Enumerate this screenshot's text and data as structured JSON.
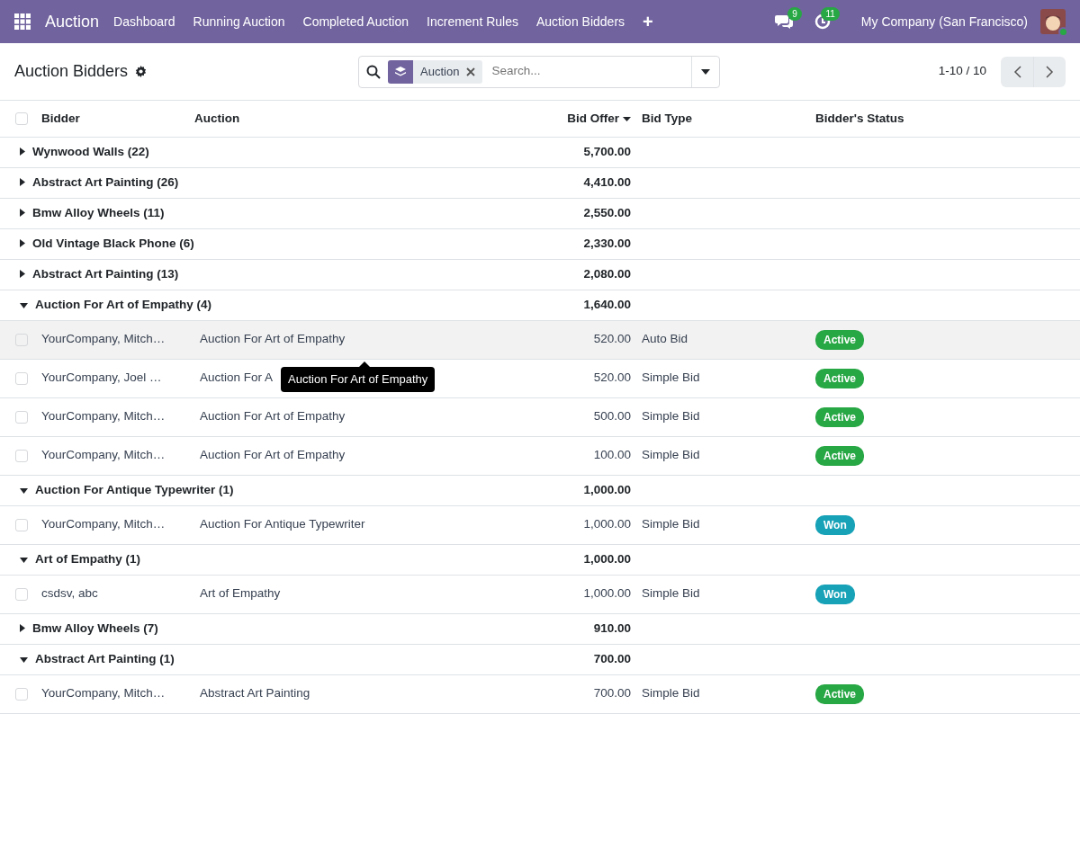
{
  "navbar": {
    "app_name": "Auction",
    "menu": [
      "Dashboard",
      "Running Auction",
      "Completed Auction",
      "Increment Rules",
      "Auction Bidders"
    ],
    "plus": "+",
    "messages_count": "9",
    "activities_count": "11",
    "company": "My Company (San Francisco)",
    "user_online": true
  },
  "control_panel": {
    "title": "Auction Bidders",
    "facet": "Auction",
    "search": {
      "placeholder": "Search..."
    },
    "pager": "1-10 / 10"
  },
  "table": {
    "all_selected": false,
    "columns": [
      {
        "label": "Bidder",
        "sorted": false
      },
      {
        "label": "Auction",
        "sorted": false
      },
      {
        "label": "Bid Offer",
        "sorted": true
      },
      {
        "label": "Bid Type",
        "sorted": false
      },
      {
        "label": "Bidder's Status",
        "sorted": false
      }
    ],
    "groups": [
      {
        "label": "Wynwood Walls (22)",
        "total": "5,700.00",
        "expanded": false
      },
      {
        "label": "Abstract Art Painting (26)",
        "total": "4,410.00",
        "expanded": false
      },
      {
        "label": "Bmw Alloy Wheels (11)",
        "total": "2,550.00",
        "expanded": false
      },
      {
        "label": "Old Vintage Black Phone (6)",
        "total": "2,330.00",
        "expanded": false
      },
      {
        "label": "Abstract Art Painting (13)",
        "total": "2,080.00",
        "expanded": false
      },
      {
        "label": "Auction For Art of Empathy (4)",
        "total": "1,640.00",
        "expanded": true,
        "rows": [
          {
            "bidder": "YourCompany, Mitch…",
            "auction": "Auction For Art of Empathy",
            "bid_offer": "520.00",
            "bid_type": "Auto Bid",
            "status": "Active",
            "color": "#28a745",
            "hovered": true,
            "checked": false
          },
          {
            "bidder": "YourCompany, Joel …",
            "auction": "Auction For A",
            "bid_offer": "520.00",
            "bid_type": "Simple Bid",
            "status": "Active",
            "color": "#28a745",
            "hovered": false,
            "checked": false
          },
          {
            "bidder": "YourCompany, Mitch…",
            "auction": "Auction For Art of Empathy",
            "bid_offer": "500.00",
            "bid_type": "Simple Bid",
            "status": "Active",
            "color": "#28a745",
            "hovered": false,
            "checked": false
          },
          {
            "bidder": "YourCompany, Mitch…",
            "auction": "Auction For Art of Empathy",
            "bid_offer": "100.00",
            "bid_type": "Simple Bid",
            "status": "Active",
            "color": "#28a745",
            "hovered": false,
            "checked": false
          }
        ]
      },
      {
        "label": "Auction For Antique Typewriter (1)",
        "total": "1,000.00",
        "expanded": true,
        "rows": [
          {
            "bidder": "YourCompany, Mitch…",
            "auction": "Auction For Antique Typewriter",
            "bid_offer": "1,000.00",
            "bid_type": "Simple Bid",
            "status": "Won",
            "color": "#17a2b8",
            "hovered": false,
            "checked": false
          }
        ]
      },
      {
        "label": "Art of Empathy (1)",
        "total": "1,000.00",
        "expanded": true,
        "rows": [
          {
            "bidder": "csdsv, abc",
            "auction": "Art of Empathy",
            "bid_offer": "1,000.00",
            "bid_type": "Simple Bid",
            "status": "Won",
            "color": "#17a2b8",
            "hovered": false,
            "checked": false
          }
        ]
      },
      {
        "label": "Bmw Alloy Wheels (7)",
        "total": "910.00",
        "expanded": false
      },
      {
        "label": "Abstract Art Painting (1)",
        "total": "700.00",
        "expanded": true,
        "rows": [
          {
            "bidder": "YourCompany, Mitch…",
            "auction": "Abstract Art Painting",
            "bid_offer": "700.00",
            "bid_type": "Simple Bid",
            "status": "Active",
            "color": "#28a745",
            "hovered": false,
            "checked": false
          }
        ]
      }
    ]
  },
  "tooltip": "Auction For Art of Empathy"
}
